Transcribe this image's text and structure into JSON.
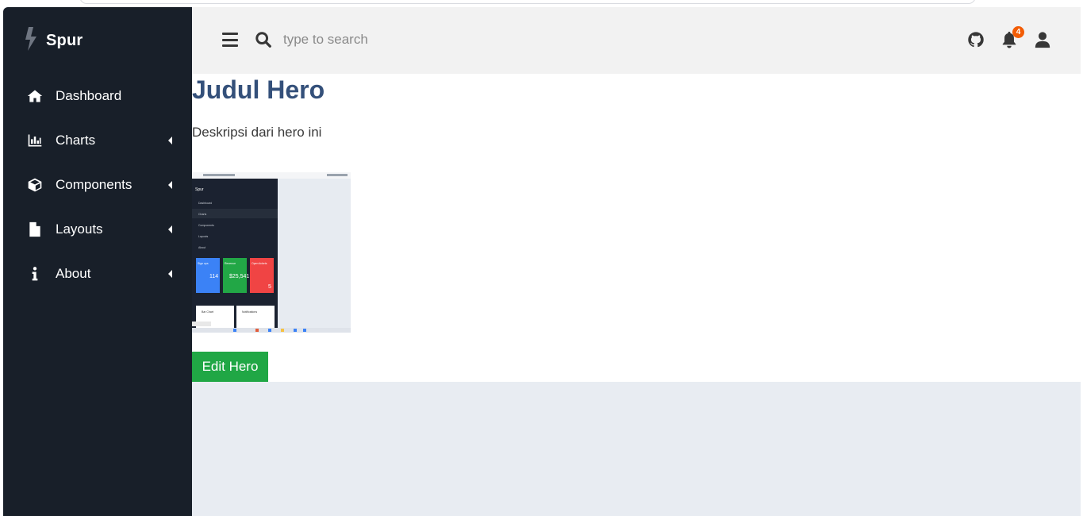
{
  "sidebar": {
    "brand": "Spur",
    "items": [
      {
        "label": "Dashboard",
        "icon": "home-icon",
        "has_caret": false
      },
      {
        "label": "Charts",
        "icon": "bar-chart-icon",
        "has_caret": true
      },
      {
        "label": "Components",
        "icon": "cube-icon",
        "has_caret": true
      },
      {
        "label": "Layouts",
        "icon": "file-icon",
        "has_caret": true
      },
      {
        "label": "About",
        "icon": "info-icon",
        "has_caret": true
      }
    ]
  },
  "topbar": {
    "search_placeholder": "type to search",
    "notification_count": "4",
    "icons": [
      "menu-icon",
      "search-icon",
      "github-icon",
      "bell-icon",
      "user-icon"
    ]
  },
  "hero": {
    "title": "Judul Hero",
    "description": "Deskripsi dari hero ini",
    "image": {
      "brand": "Spur",
      "menu": [
        "Dashboard",
        "Charts",
        "Components",
        "Layouts",
        "About"
      ],
      "cards": [
        {
          "title": "Sign ups",
          "value": "114"
        },
        {
          "title": "Revenue",
          "value": "$25,541"
        },
        {
          "title": "Open tickets",
          "value": "5"
        }
      ],
      "panels": [
        "Bar Chart",
        "Notifications"
      ]
    },
    "button_label": "Edit Hero"
  },
  "colors": {
    "sidebar_bg": "#181f29",
    "topbar_bg": "#f2f2f2",
    "title": "#34507a",
    "button": "#20a745",
    "badge": "#f25c05",
    "main_bg": "#e8ecf2"
  }
}
